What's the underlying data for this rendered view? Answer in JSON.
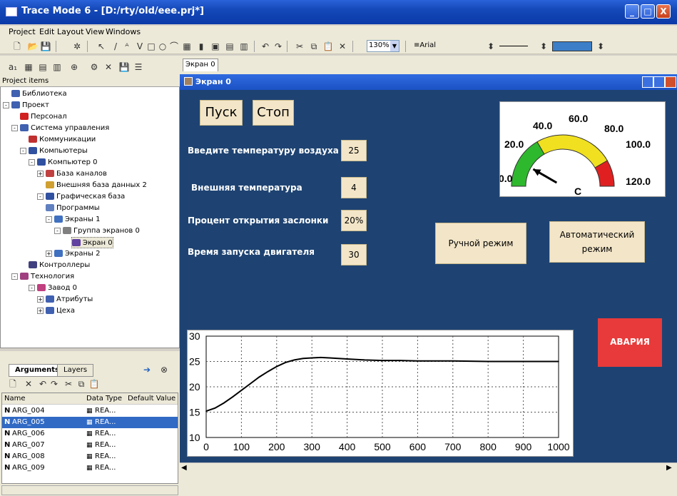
{
  "window": {
    "title": "Trace Mode 6 - [D:/rty/old/eee.prj*]",
    "minimize": "_",
    "maximize": "□",
    "close": "X"
  },
  "menu": [
    "Project",
    "Edit",
    "Layout",
    "View",
    "Windows"
  ],
  "toolbar": {
    "zoom": "130%",
    "font": "Arial"
  },
  "project_header": "Project items",
  "tree": [
    {
      "label": "Библиотека",
      "indent": 1,
      "pm": "",
      "icon": "#4060b0"
    },
    {
      "label": "Проект",
      "indent": 0,
      "pm": "-",
      "icon": "#4060b0"
    },
    {
      "label": "Персонал",
      "indent": 2,
      "pm": "",
      "icon": "#d02020"
    },
    {
      "label": "Система управления",
      "indent": 1,
      "pm": "-",
      "icon": "#4060b0"
    },
    {
      "label": "Коммуникации",
      "indent": 3,
      "pm": "",
      "icon": "#c03030"
    },
    {
      "label": "Компьютеры",
      "indent": 2,
      "pm": "-",
      "icon": "#3050a0"
    },
    {
      "label": "Компьютер 0",
      "indent": 3,
      "pm": "-",
      "icon": "#3050a0"
    },
    {
      "label": "База каналов",
      "indent": 4,
      "pm": "+",
      "icon": "#c04040"
    },
    {
      "label": "Внешняя база данных 2",
      "indent": 5,
      "pm": "",
      "icon": "#d0a030"
    },
    {
      "label": "Графическая база",
      "indent": 4,
      "pm": "-",
      "icon": "#3050a0"
    },
    {
      "label": "Программы",
      "indent": 5,
      "pm": "",
      "icon": "#6080c0"
    },
    {
      "label": "Экраны 1",
      "indent": 5,
      "pm": "-",
      "icon": "#4070c0"
    },
    {
      "label": "Группа экранов 0",
      "indent": 6,
      "pm": "-",
      "icon": "#808080"
    },
    {
      "label": "Экран 0",
      "indent": 8,
      "pm": "",
      "icon": "#6040a0",
      "selected": true
    },
    {
      "label": "Экраны 2",
      "indent": 5,
      "pm": "+",
      "icon": "#4070c0"
    },
    {
      "label": "Контроллеры",
      "indent": 3,
      "pm": "",
      "icon": "#404080"
    },
    {
      "label": "Технология",
      "indent": 1,
      "pm": "-",
      "icon": "#a04080"
    },
    {
      "label": "Завод 0",
      "indent": 3,
      "pm": "-",
      "icon": "#c04080"
    },
    {
      "label": "Атрибуты",
      "indent": 4,
      "pm": "+",
      "icon": "#4060b0"
    },
    {
      "label": "Цеха",
      "indent": 4,
      "pm": "+",
      "icon": "#4060b0"
    }
  ],
  "arg_tabs": [
    "Arguments",
    "Layers"
  ],
  "arg_columns": [
    "Name",
    "Data Type",
    "Default Value"
  ],
  "args": [
    {
      "name": "ARG_004",
      "type": "REA..."
    },
    {
      "name": "ARG_005",
      "type": "REA...",
      "selected": true
    },
    {
      "name": "ARG_006",
      "type": "REA..."
    },
    {
      "name": "ARG_007",
      "type": "REA..."
    },
    {
      "name": "ARG_008",
      "type": "REA..."
    },
    {
      "name": "ARG_009",
      "type": "REA..."
    }
  ],
  "doc_tab": "Экран 0",
  "screen_title": "Экран 0",
  "buttons": {
    "start": "Пуск",
    "stop": "Стоп",
    "manual": "Ручной режим",
    "auto": "Автоматический режим",
    "alarm": "АВАРИЯ"
  },
  "fields": [
    {
      "label": "Введите температуру воздуха",
      "value": "25"
    },
    {
      "label": "Внешняя температура",
      "value": "4"
    },
    {
      "label": "Процент открытия заслонки",
      "value": "20%"
    },
    {
      "label": "Время запуска двигателя",
      "value": "30"
    }
  ],
  "gauge": {
    "ticks": [
      "0.0",
      "20.0",
      "40.0",
      "60.0",
      "80.0",
      "100.0",
      "120.0"
    ],
    "unit": "C",
    "value": 20
  },
  "chart_data": {
    "type": "line",
    "x": [
      0,
      25,
      50,
      75,
      100,
      125,
      150,
      175,
      200,
      225,
      250,
      275,
      300,
      325,
      350,
      375,
      400,
      450,
      500,
      550,
      600,
      700,
      800,
      900,
      1000
    ],
    "y": [
      15.2,
      15.8,
      16.8,
      18.0,
      19.3,
      20.6,
      21.9,
      23.0,
      24.0,
      24.8,
      25.3,
      25.6,
      25.7,
      25.8,
      25.7,
      25.6,
      25.5,
      25.3,
      25.2,
      25.2,
      25.1,
      25.1,
      25.0,
      25.0,
      25.0
    ],
    "xlim": [
      0,
      1000
    ],
    "ylim": [
      10,
      30
    ],
    "x_ticks": [
      "0",
      "100",
      "200",
      "300",
      "400",
      "500",
      "600",
      "700",
      "800",
      "900",
      "1000"
    ],
    "y_ticks": [
      "10",
      "15",
      "20",
      "25",
      "30"
    ],
    "grid": true,
    "title": "",
    "xlabel": "",
    "ylabel": ""
  }
}
